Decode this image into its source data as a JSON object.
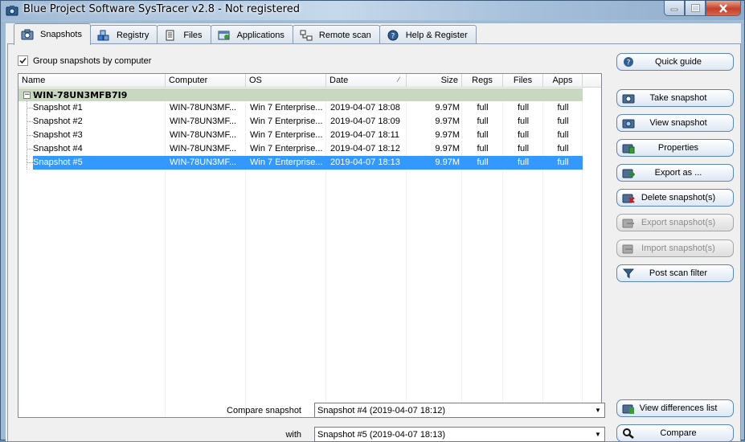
{
  "window": {
    "title": "Blue Project Software SysTracer v2.8 - Not registered"
  },
  "tabs": [
    {
      "label": "Snapshots",
      "icon": "camera-icon"
    },
    {
      "label": "Registry",
      "icon": "registry-icon"
    },
    {
      "label": "Files",
      "icon": "files-icon"
    },
    {
      "label": "Applications",
      "icon": "applications-icon"
    },
    {
      "label": "Remote scan",
      "icon": "remote-scan-icon"
    },
    {
      "label": "Help & Register",
      "icon": "help-icon"
    }
  ],
  "options": {
    "group_by_computer_label": "Group snapshots by computer",
    "group_by_computer_checked": true
  },
  "list": {
    "columns": [
      "Name",
      "Computer",
      "OS",
      "Date",
      "Size",
      "Regs",
      "Files",
      "Apps"
    ],
    "group": "WIN-78UN3MFB7I9",
    "group_toggle": "−",
    "rows": [
      {
        "name": "Snapshot #1",
        "computer": "WIN-78UN3MF...",
        "os": "Win 7 Enterprise...",
        "date": "2019-04-07 18:08",
        "size": "9.97M",
        "regs": "full",
        "files": "full",
        "apps": "full"
      },
      {
        "name": "Snapshot #2",
        "computer": "WIN-78UN3MF...",
        "os": "Win 7 Enterprise...",
        "date": "2019-04-07 18:09",
        "size": "9.97M",
        "regs": "full",
        "files": "full",
        "apps": "full"
      },
      {
        "name": "Snapshot #3",
        "computer": "WIN-78UN3MF...",
        "os": "Win 7 Enterprise...",
        "date": "2019-04-07 18:11",
        "size": "9.97M",
        "regs": "full",
        "files": "full",
        "apps": "full"
      },
      {
        "name": "Snapshot #4",
        "computer": "WIN-78UN3MF...",
        "os": "Win 7 Enterprise...",
        "date": "2019-04-07 18:12",
        "size": "9.97M",
        "regs": "full",
        "files": "full",
        "apps": "full"
      },
      {
        "name": "Snapshot #5",
        "computer": "WIN-78UN3MF...",
        "os": "Win 7 Enterprise...",
        "date": "2019-04-07 18:13",
        "size": "9.97M",
        "regs": "full",
        "files": "full",
        "apps": "full",
        "selected": true
      }
    ]
  },
  "buttons": {
    "quick_guide": "Quick guide",
    "take_snapshot": "Take snapshot",
    "view_snapshot": "View snapshot",
    "properties": "Properties",
    "export_as": "Export as ...",
    "delete_snapshots": "Delete snapshot(s)",
    "export_snapshots": "Export snapshot(s)",
    "import_snapshots": "Import snapshot(s)",
    "post_scan_filter": "Post scan filter",
    "view_differences": "View differences list",
    "compare": "Compare"
  },
  "compare": {
    "label": "Compare snapshot",
    "value": "Snapshot #4 (2019-04-07 18:12)",
    "with_label": "with",
    "with_value": "Snapshot #5 (2019-04-07 18:13)"
  },
  "colors": {
    "selection": "#3399ff",
    "group_row": "#c9d8c0",
    "button_border": "#5a86b8"
  }
}
